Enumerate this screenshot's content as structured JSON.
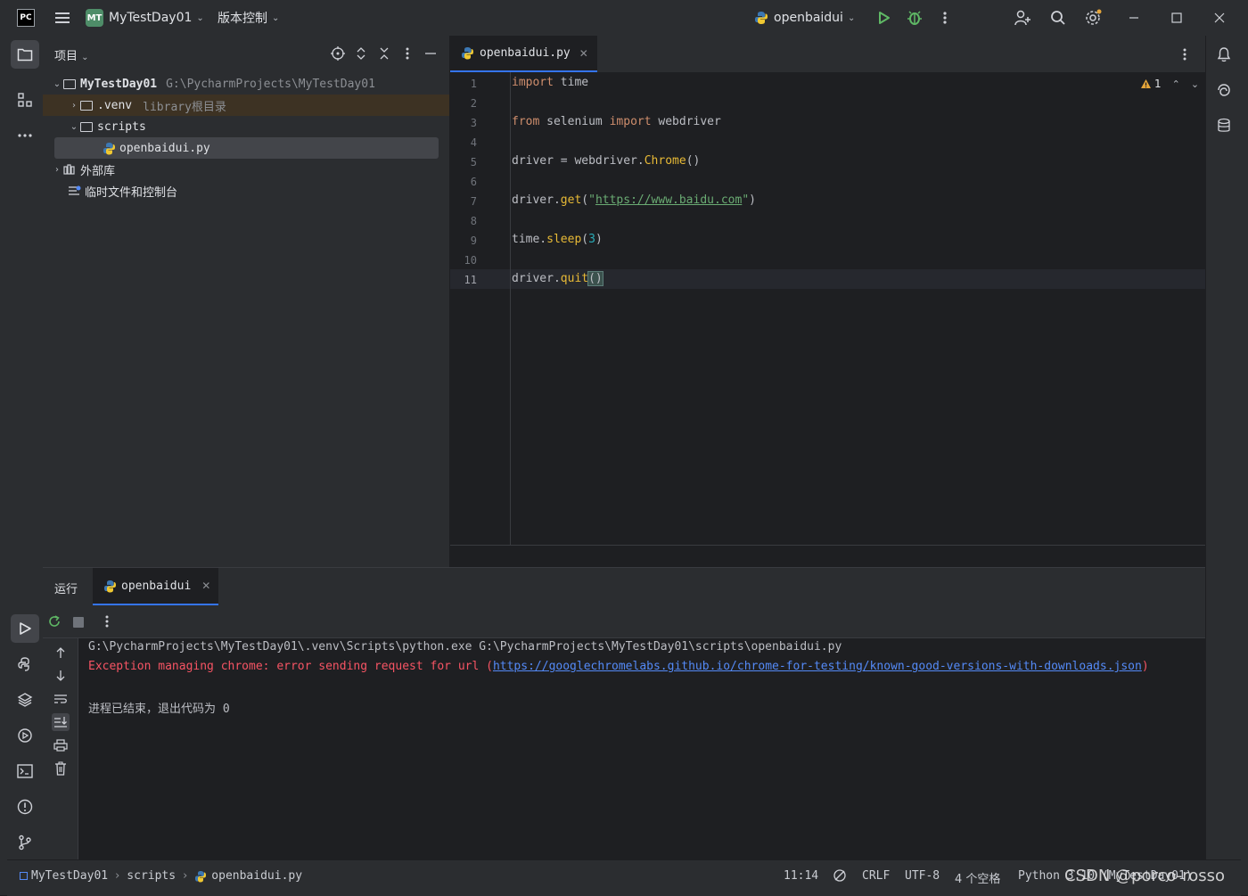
{
  "window": {
    "app_logo": "PC",
    "project_badge": "MT",
    "project_name": "MyTestDay01",
    "vcs_menu": "版本控制",
    "run_config": "openbaidui"
  },
  "project_panel": {
    "title": "项目",
    "tree": [
      {
        "name": "MyTestDay01",
        "hint": "G:\\PycharmProjects\\MyTestDay01"
      },
      {
        "name": ".venv",
        "hint": "library根目录"
      },
      {
        "name": "scripts",
        "hint": ""
      },
      {
        "name": "openbaidui.py",
        "hint": ""
      },
      {
        "name": "外部库",
        "hint": ""
      },
      {
        "name": "临时文件和控制台",
        "hint": ""
      }
    ]
  },
  "editor": {
    "tab_label": "openbaidui.py",
    "warning_count": "1",
    "line_numbers": [
      "1",
      "2",
      "3",
      "4",
      "5",
      "6",
      "7",
      "8",
      "9",
      "10",
      "11"
    ],
    "code": {
      "l1_kw": "import",
      "l1_rest": " time",
      "l3_kw": "from",
      "l3_mod": " selenium ",
      "l3_kw2": "import",
      "l3_rest": " webdriver",
      "l5_a": "driver = webdriver.",
      "l5_fn": "Chrome",
      "l5_b": "()",
      "l7_a": "driver.",
      "l7_fn": "get",
      "l7_b": "(",
      "l7_q1": "\"",
      "l7_url": "https://www.baidu.com",
      "l7_q2": "\"",
      "l7_c": ")",
      "l9_a": "time.",
      "l9_fn": "sleep",
      "l9_b": "(",
      "l9_num": "3",
      "l9_c": ")",
      "l11_a": "driver.",
      "l11_fn": "quit",
      "l11_b": "()"
    }
  },
  "run_panel": {
    "title": "运行",
    "tab_label": "openbaidui",
    "output": {
      "cmd": "G:\\PycharmProjects\\MyTestDay01\\.venv\\Scripts\\python.exe G:\\PycharmProjects\\MyTestDay01\\scripts\\openbaidui.py",
      "err_prefix": "Exception managing chrome: error sending request for url (",
      "err_url": "https://googlechromelabs.github.io/chrome-for-testing/known-good-versions-with-downloads.json",
      "err_suffix": ")",
      "exit": "进程已结束，退出代码为 0"
    }
  },
  "status_bar": {
    "crumb_project": "MyTestDay01",
    "crumb_folder": "scripts",
    "crumb_file": "openbaidui.py",
    "position": "11:14",
    "line_ending": "CRLF",
    "encoding": "UTF-8",
    "indent": "4 个空格",
    "interpreter": "Python 3.10 (MyTestDay01)"
  },
  "watermark": "CSDN @porco-rosso",
  "colors": {
    "accent": "#3574f0",
    "error": "#f75464",
    "link": "#548af7",
    "keyword": "#cf8e6d",
    "string": "#6aab73",
    "run_green": "#5fb865"
  },
  "icons": [
    "menu-icon",
    "run-icon",
    "debug-icon",
    "more-icon",
    "add-user-icon",
    "search-icon",
    "settings-icon",
    "minimize-icon",
    "maximize-icon",
    "close-icon",
    "folder-icon",
    "structure-icon",
    "locate-icon",
    "expand-collapse-icon",
    "close-panel-icon",
    "hide-icon",
    "python-file-icon",
    "library-icon",
    "scratch-icon",
    "notifications-icon",
    "ai-assistant-icon",
    "database-icon",
    "rerun-icon",
    "stop-icon",
    "up-icon",
    "down-icon",
    "wrap-icon",
    "scroll-end-icon",
    "print-icon",
    "trash-icon",
    "python-console-icon",
    "services-icon",
    "terminal-icon",
    "problems-icon",
    "git-icon",
    "warning-icon"
  ]
}
